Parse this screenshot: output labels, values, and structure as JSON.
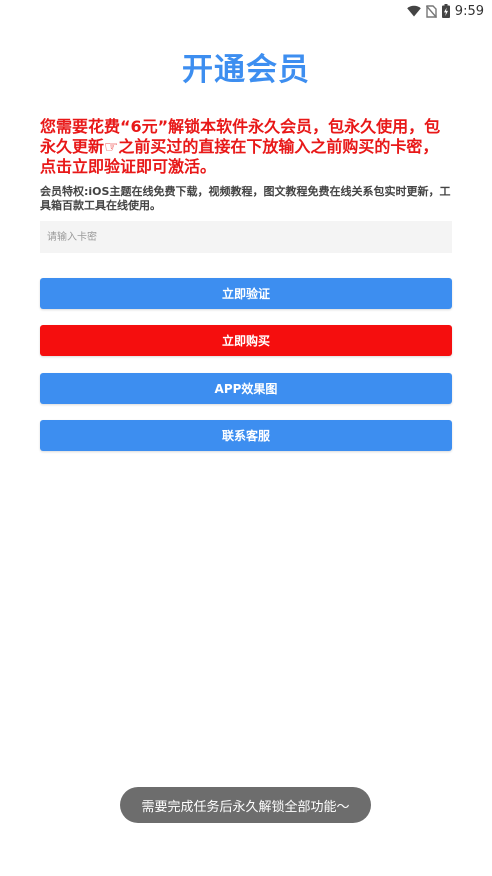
{
  "status_bar": {
    "time": "9:59",
    "icons": [
      "wifi-icon",
      "no-sim-icon",
      "battery-charging-icon"
    ]
  },
  "page": {
    "title": "开通会员",
    "notice": "您需要花费“6元”解锁本软件永久会员，包永久使用，包永久更新☞之前买过的直接在下放输入之前购买的卡密，点击立即验证即可激活。",
    "benefits": "会员特权:iOS主题在线免费下载，视频教程，图文教程免费在线关系包实时更新，工具箱百款工具在线使用。"
  },
  "form": {
    "card_placeholder": "请输入卡密",
    "card_value": ""
  },
  "buttons": {
    "verify": "立即验证",
    "buy": "立即购买",
    "preview": "APP效果图",
    "contact": "联系客服"
  },
  "toast": {
    "message": "需要完成任务后永久解锁全部功能～"
  },
  "colors": {
    "accent": "#3d8ef0",
    "danger": "#f50e0e",
    "notice_text": "#e81818",
    "toast_bg": "#6d6d6d"
  }
}
